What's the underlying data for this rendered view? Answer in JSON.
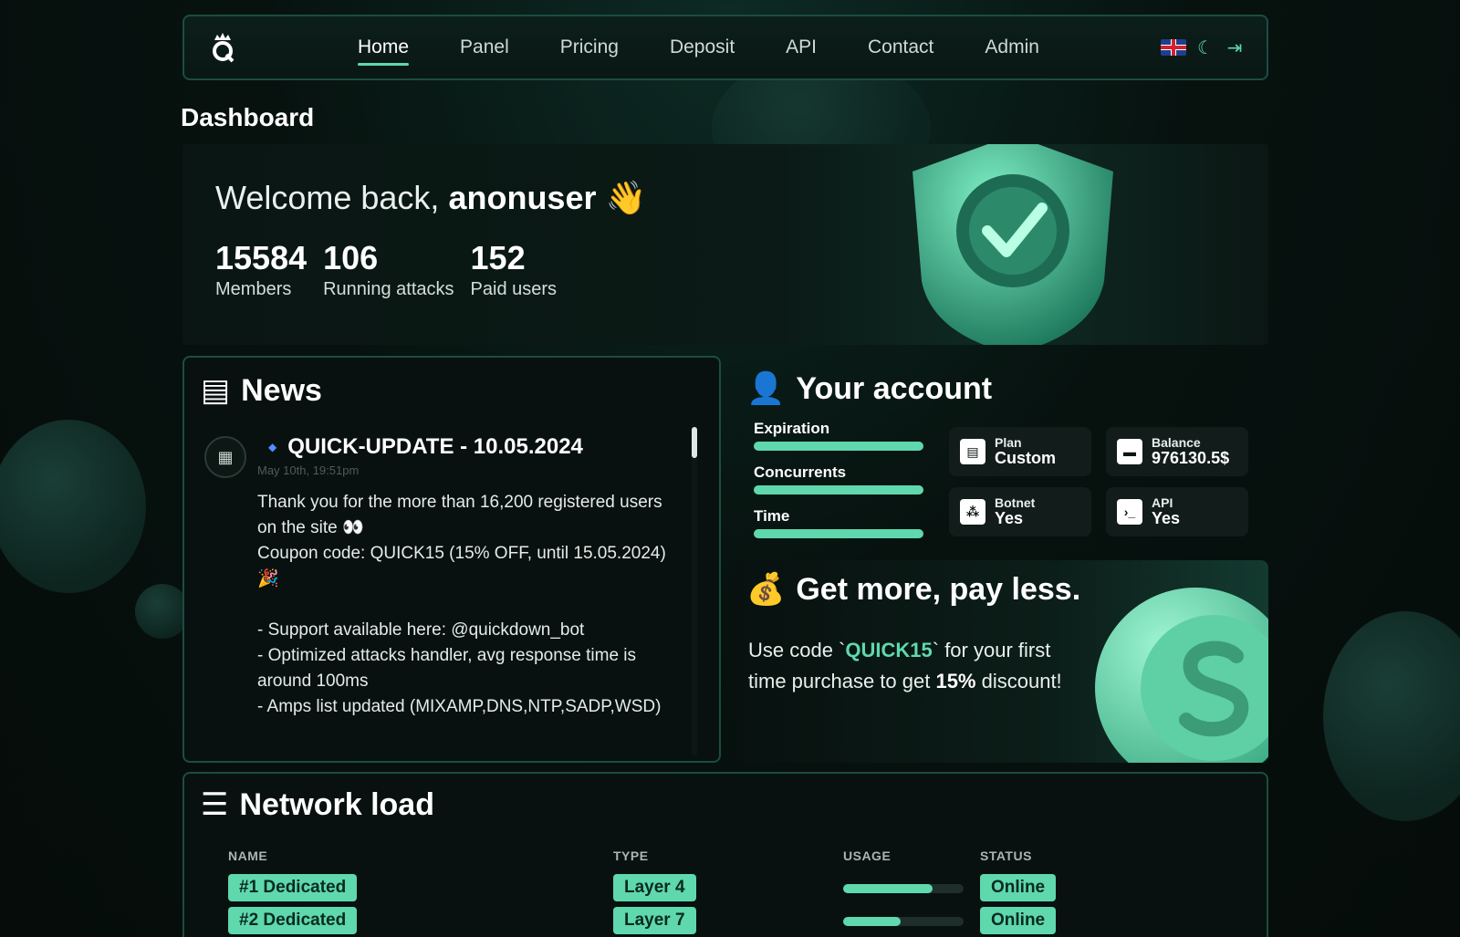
{
  "nav": {
    "links": [
      "Home",
      "Panel",
      "Pricing",
      "Deposit",
      "API",
      "Contact",
      "Admin"
    ],
    "active": "Home",
    "icons": [
      "uk-flag-icon",
      "moon-icon",
      "logout-icon"
    ]
  },
  "page": {
    "title": "Dashboard"
  },
  "hero": {
    "welcome_prefix": "Welcome back,",
    "username": "anonuser",
    "wave": "👋",
    "stats": [
      {
        "value": "15584",
        "label": "Members"
      },
      {
        "value": "106",
        "label": "Running attacks"
      },
      {
        "value": "152",
        "label": "Paid users"
      }
    ]
  },
  "news": {
    "title": "News",
    "item": {
      "headline": "QUICK-UPDATE - 10.05.2024",
      "date": "May 10th, 19:51pm",
      "lines": [
        "Thank you for the more than 16,200 registered users on the site 👀",
        "Coupon code: QUICK15 (15% OFF, until 15.05.2024)",
        "🎉",
        "",
        "- Support available here: @quickdown_bot",
        "- Optimized attacks handler, avg response time is around 100ms",
        "- Amps list updated (MIXAMP,DNS,NTP,SADP,WSD)"
      ]
    }
  },
  "account": {
    "title": "Your account",
    "bars": [
      {
        "label": "Expiration",
        "fill": 1.0
      },
      {
        "label": "Concurrents",
        "fill": 1.0
      },
      {
        "label": "Time",
        "fill": 1.0
      }
    ],
    "tiles": [
      {
        "icon": "id-card-icon",
        "glyph": "▤",
        "label": "Plan",
        "value": "Custom"
      },
      {
        "icon": "wallet-icon",
        "glyph": "▬",
        "label": "Balance",
        "value": "976130.5$"
      },
      {
        "icon": "botnet-icon",
        "glyph": "⁂",
        "label": "Botnet",
        "value": "Yes"
      },
      {
        "icon": "terminal-icon",
        "glyph": "›_",
        "label": "API",
        "value": "Yes"
      }
    ]
  },
  "promo": {
    "title": "Get more, pay less.",
    "text_before": "Use code `",
    "code": "QUICK15",
    "text_middle": "` for your first time purchase to get ",
    "bold": "15%",
    "text_after": " discount!"
  },
  "network": {
    "title": "Network load",
    "headers": [
      "NAME",
      "TYPE",
      "USAGE",
      "STATUS"
    ],
    "rows": [
      {
        "name": "#1 Dedicated",
        "type": "Layer 4",
        "usage": 0.74,
        "status": "Online"
      },
      {
        "name": "#2 Dedicated",
        "type": "Layer 7",
        "usage": 0.48,
        "status": "Online"
      }
    ]
  },
  "colors": {
    "accent": "#5fd8ad",
    "border": "#1b4d42",
    "background": "#07120f"
  }
}
